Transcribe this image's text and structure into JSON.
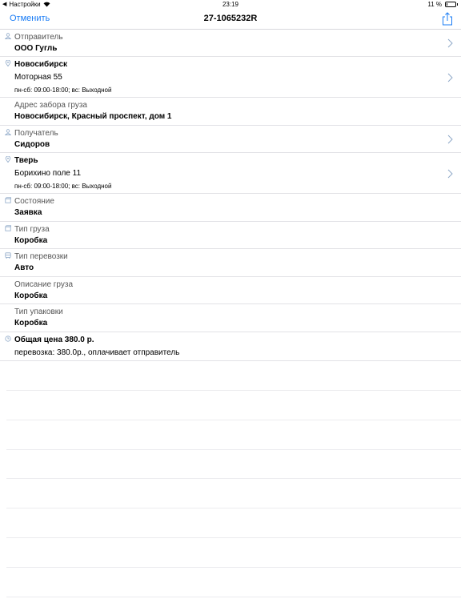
{
  "status_bar": {
    "back_app": "Настройки",
    "time": "23:19",
    "battery_percent": "11 %",
    "battery_level": 0.11
  },
  "navbar": {
    "cancel_label": "Отменить",
    "title": "27-1065232R",
    "share_icon": "share-icon"
  },
  "sender": {
    "label": "Отправитель",
    "value": "ООО Гугль"
  },
  "sender_address": {
    "city": "Новосибирск",
    "street": "Моторная 55",
    "hours": "пн-сб: 09:00-18:00; вс: Выходной"
  },
  "pickup": {
    "label": "Адрес забора груза",
    "value": "Новосибирск, Красный проспект, дом 1"
  },
  "recipient": {
    "label": "Получатель",
    "value": "Сидоров"
  },
  "recipient_address": {
    "city": "Тверь",
    "street": "Борихино поле 11",
    "hours": "пн-сб: 09:00-18:00; вс: Выходной"
  },
  "state": {
    "label": "Состояние",
    "value": "Заявка"
  },
  "cargo_type": {
    "label": "Тип груза",
    "value": "Коробка"
  },
  "transport_type": {
    "label": "Тип перевозки",
    "value": "Авто"
  },
  "cargo_description": {
    "label": "Описание груза",
    "value": "Коробка"
  },
  "packaging_type": {
    "label": "Тип упаковки",
    "value": "Коробка"
  },
  "total": {
    "title": "Общая цена 380.0 р.",
    "detail": "перевозка: 380.0р., оплачивает отправитель"
  },
  "colors": {
    "accent": "#1a7cf5",
    "icon": "#8fa9c8",
    "separator": "#e2e2e6"
  }
}
